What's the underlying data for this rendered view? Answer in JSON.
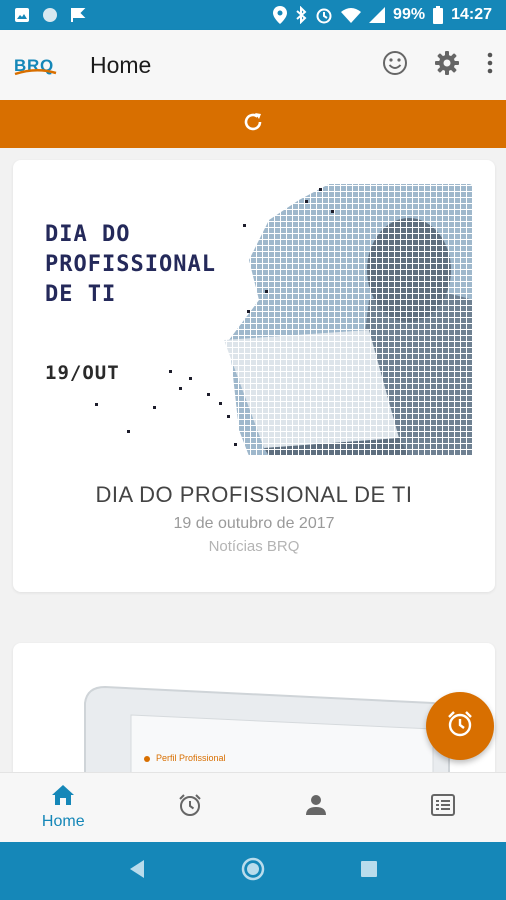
{
  "status_bar": {
    "battery": "99%",
    "time": "14:27",
    "icons": [
      "image-icon",
      "circle-icon",
      "flag-icon",
      "location-icon",
      "bluetooth-icon",
      "alarm-icon",
      "wifi-icon",
      "signal-icon",
      "battery-icon"
    ]
  },
  "app_bar": {
    "logo_text": "BRQ",
    "title": "Home",
    "actions": [
      "smiley-icon",
      "gear-icon",
      "more-vert-icon"
    ]
  },
  "refresh": {
    "icon": "refresh-icon"
  },
  "news": [
    {
      "banner_line1": "DIA DO",
      "banner_line2": "PROFISSIONAL",
      "banner_line3": "DE TI",
      "banner_date": "19/OUT",
      "title": "DIA DO PROFISSIONAL DE TI",
      "date": "19 de outubro de 2017",
      "source": "Notícias BRQ"
    },
    {
      "preview_text": "Perfil Profissional"
    }
  ],
  "fab": {
    "icon": "alarm-icon"
  },
  "bottom_nav": {
    "items": [
      {
        "icon": "home-icon",
        "label": "Home",
        "active": true
      },
      {
        "icon": "alarm-icon",
        "label": "",
        "active": false
      },
      {
        "icon": "person-icon",
        "label": "",
        "active": false
      },
      {
        "icon": "list-icon",
        "label": "",
        "active": false
      }
    ]
  },
  "colors": {
    "status": "#1587b8",
    "accent": "#d86f00",
    "active_nav": "#1587b8",
    "banner_text": "#24295a"
  }
}
